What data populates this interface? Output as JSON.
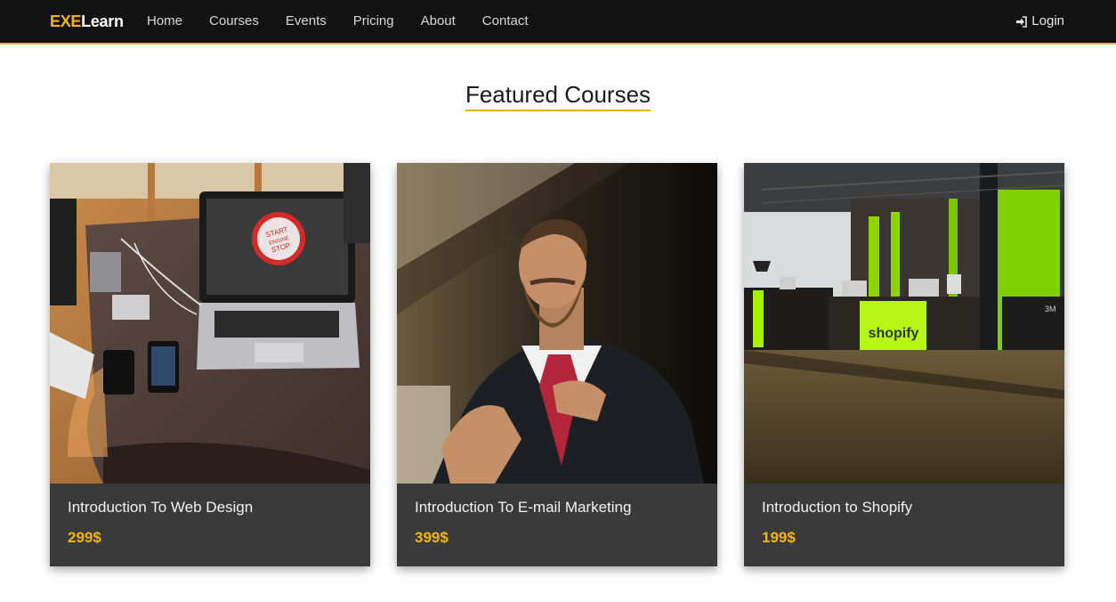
{
  "brand": {
    "part1": "EXE",
    "part2": "Learn"
  },
  "nav": {
    "links": [
      "Home",
      "Courses",
      "Events",
      "Pricing",
      "About",
      "Contact"
    ],
    "login": "Login"
  },
  "section": {
    "title": "Featured Courses"
  },
  "courses": [
    {
      "title": "Introduction To Web Design",
      "price": "299$",
      "image": "laptop-desk-photo"
    },
    {
      "title": "Introduction To E-mail Marketing",
      "price": "399$",
      "image": "bearded-man-suit-photo"
    },
    {
      "title": "Introduction to Shopify",
      "price": "199$",
      "image": "shopify-office-photo"
    }
  ],
  "image_text": {
    "start_engine_stop": [
      "START",
      "ENGINE",
      "STOP"
    ],
    "shopify_sign": "shopify",
    "logo_3m": "3M"
  },
  "colors": {
    "accent": "#f2b705",
    "navbar": "#121212",
    "card": "#3a3a3a"
  }
}
